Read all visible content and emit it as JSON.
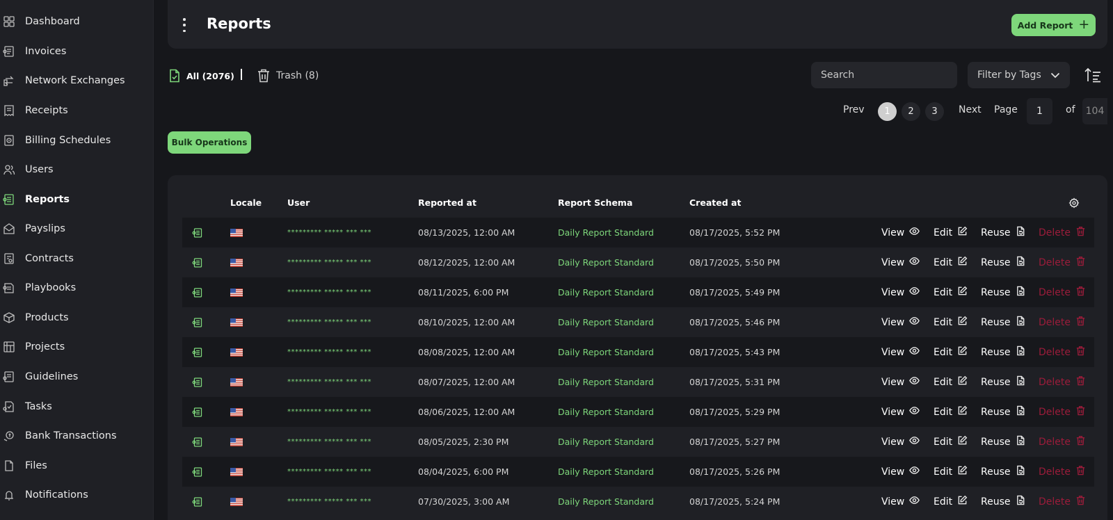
{
  "sidebar": {
    "items": [
      {
        "label": "Dashboard",
        "icon": "dashboard-icon"
      },
      {
        "label": "Invoices",
        "icon": "invoice-icon"
      },
      {
        "label": "Network Exchanges",
        "icon": "exchange-icon"
      },
      {
        "label": "Receipts",
        "icon": "receipt-icon"
      },
      {
        "label": "Billing Schedules",
        "icon": "billing-icon"
      },
      {
        "label": "Users",
        "icon": "users-icon"
      },
      {
        "label": "Reports",
        "icon": "reports-icon",
        "active": true
      },
      {
        "label": "Payslips",
        "icon": "payslip-icon"
      },
      {
        "label": "Contracts",
        "icon": "contract-icon"
      },
      {
        "label": "Playbooks",
        "icon": "playbook-icon"
      },
      {
        "label": "Products",
        "icon": "product-icon"
      },
      {
        "label": "Projects",
        "icon": "project-icon"
      },
      {
        "label": "Guidelines",
        "icon": "guideline-icon"
      },
      {
        "label": "Tasks",
        "icon": "task-icon"
      },
      {
        "label": "Bank Transactions",
        "icon": "bank-icon"
      },
      {
        "label": "Files",
        "icon": "file-icon"
      },
      {
        "label": "Notifications",
        "icon": "notification-icon"
      }
    ]
  },
  "header": {
    "title": "Reports",
    "add_button": "Add Report"
  },
  "tabs": {
    "all": "All (2076)",
    "trash": "Trash (8)"
  },
  "search": {
    "placeholder": "Search"
  },
  "filter": {
    "label": "Filter by Tags"
  },
  "pagination": {
    "prev": "Prev",
    "pages": [
      "1",
      "2",
      "3"
    ],
    "current": "1",
    "next": "Next",
    "page_label": "Page",
    "page_value": "1",
    "of_label": "of",
    "total_pages": "104"
  },
  "bulk_button": "Bulk Operations",
  "table": {
    "headers": {
      "locale": "Locale",
      "user": "User",
      "reported_at": "Reported at",
      "schema": "Report Schema",
      "created_at": "Created at"
    },
    "actions": {
      "view": "View",
      "edit": "Edit",
      "reuse": "Reuse",
      "delete": "Delete"
    },
    "rows": [
      {
        "user": "********* ***** *** ***",
        "reported_at": "08/13/2025, 12:00 AM",
        "schema": "Daily Report Standard",
        "created_at": "08/17/2025, 5:52 PM"
      },
      {
        "user": "********* ***** *** ***",
        "reported_at": "08/12/2025, 12:00 AM",
        "schema": "Daily Report Standard",
        "created_at": "08/17/2025, 5:50 PM"
      },
      {
        "user": "********* ***** *** ***",
        "reported_at": "08/11/2025, 6:00 PM",
        "schema": "Daily Report Standard",
        "created_at": "08/17/2025, 5:49 PM"
      },
      {
        "user": "********* ***** *** ***",
        "reported_at": "08/10/2025, 12:00 AM",
        "schema": "Daily Report Standard",
        "created_at": "08/17/2025, 5:46 PM"
      },
      {
        "user": "********* ***** *** ***",
        "reported_at": "08/08/2025, 12:00 AM",
        "schema": "Daily Report Standard",
        "created_at": "08/17/2025, 5:43 PM"
      },
      {
        "user": "********* ***** *** ***",
        "reported_at": "08/07/2025, 12:00 AM",
        "schema": "Daily Report Standard",
        "created_at": "08/17/2025, 5:31 PM"
      },
      {
        "user": "********* ***** *** ***",
        "reported_at": "08/06/2025, 12:00 AM",
        "schema": "Daily Report Standard",
        "created_at": "08/17/2025, 5:29 PM"
      },
      {
        "user": "********* ***** *** ***",
        "reported_at": "08/05/2025, 2:30 PM",
        "schema": "Daily Report Standard",
        "created_at": "08/17/2025, 5:27 PM"
      },
      {
        "user": "********* ***** *** ***",
        "reported_at": "08/04/2025, 6:00 PM",
        "schema": "Daily Report Standard",
        "created_at": "08/17/2025, 5:26 PM"
      },
      {
        "user": "********* ***** *** ***",
        "reported_at": "07/30/2025, 3:00 AM",
        "schema": "Daily Report Standard",
        "created_at": "08/17/2025, 5:24 PM"
      }
    ]
  },
  "colors": {
    "accent": "#7ed77b",
    "delete": "#9b1c3a",
    "background": "#16171b",
    "sidebar": "#1f2025"
  }
}
